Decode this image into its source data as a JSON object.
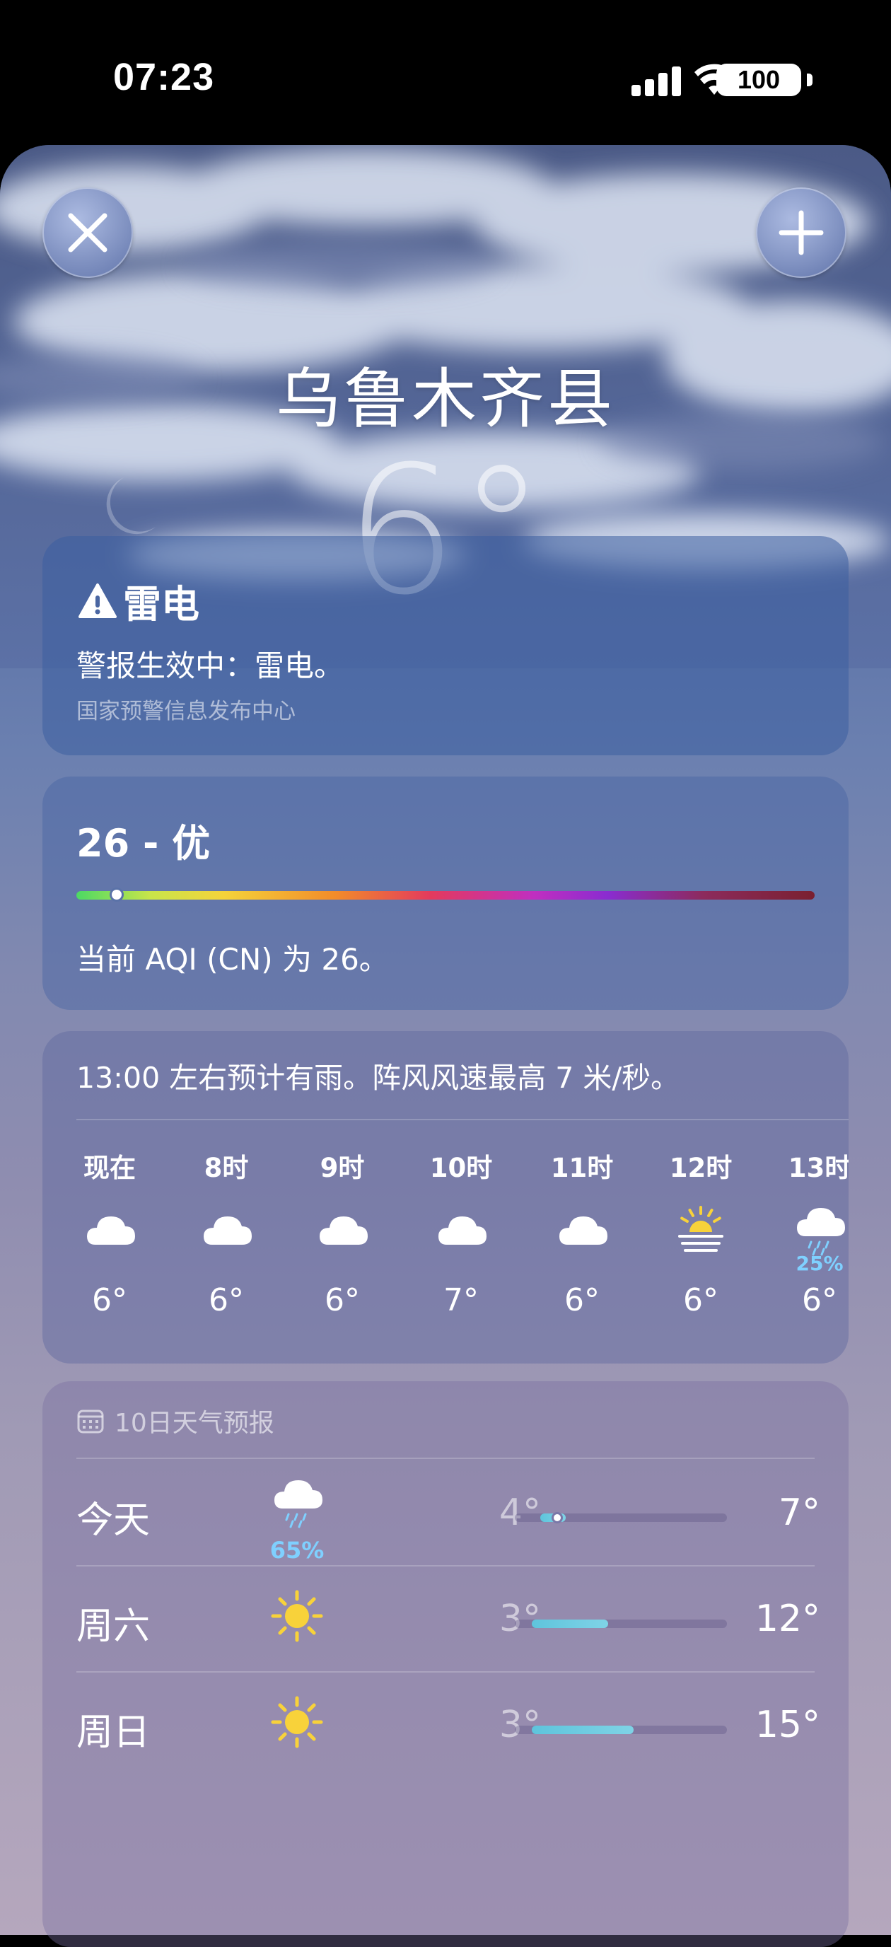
{
  "status_bar": {
    "time": "07:23",
    "battery": "100"
  },
  "location": {
    "city": "乌鲁木齐县",
    "temperature": "6°"
  },
  "alert": {
    "title": "雷电",
    "body": "警报生效中：雷电。",
    "source": "国家预警信息发布中心"
  },
  "aqi": {
    "value_label": "26 - 优",
    "level_fraction": 0.055,
    "description": "当前 AQI (CN) 为 26。"
  },
  "hourly": {
    "summary": "13:00 左右预计有雨。阵风风速最高 7 米/秒。",
    "items": [
      {
        "time": "现在",
        "icon": "cloud-icon",
        "precip": "",
        "temp": "6°"
      },
      {
        "time": "8时",
        "icon": "cloud-icon",
        "precip": "",
        "temp": "6°"
      },
      {
        "time": "9时",
        "icon": "cloud-icon",
        "precip": "",
        "temp": "6°"
      },
      {
        "time": "10时",
        "icon": "cloud-icon",
        "precip": "",
        "temp": "7°"
      },
      {
        "time": "11时",
        "icon": "cloud-icon",
        "precip": "",
        "temp": "6°"
      },
      {
        "time": "12时",
        "icon": "sunrise-icon",
        "precip": "",
        "temp": "6°"
      },
      {
        "time": "13时",
        "icon": "rain-cloud-icon",
        "precip": "25%",
        "temp": "6°"
      }
    ]
  },
  "daily": {
    "header": "10日天气预报",
    "items": [
      {
        "day": "今天",
        "icon": "rain-cloud-icon",
        "precip": "65%",
        "low": "4°",
        "high": "7°",
        "low_value": 4,
        "high_value": 7,
        "current_value": 6
      },
      {
        "day": "周六",
        "icon": "sun-icon",
        "precip": "",
        "low": "3°",
        "high": "12°",
        "low_value": 3,
        "high_value": 12
      },
      {
        "day": "周日",
        "icon": "sun-icon",
        "precip": "",
        "low": "3°",
        "high": "15°",
        "low_value": 3,
        "high_value": 15
      }
    ],
    "range_min": 1,
    "range_max": 26
  },
  "colors": {
    "accent_rain": "#7fd0ff",
    "sun": "#f8d23a",
    "range_bar": "#6fcde2"
  }
}
